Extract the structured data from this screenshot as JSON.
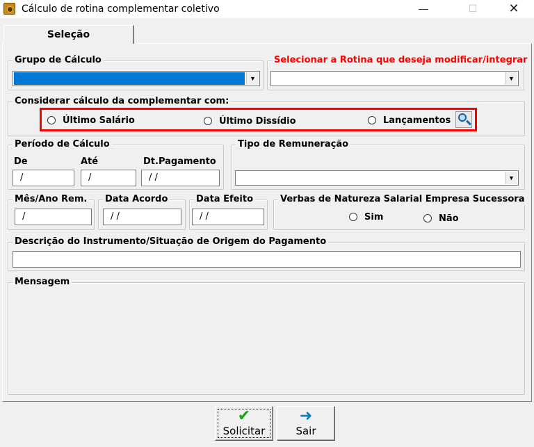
{
  "window": {
    "title": "Cálculo de rotina complementar coletivo",
    "minimize": "—",
    "maximize": "☐",
    "close": "✕"
  },
  "tab": {
    "label": "Seleção"
  },
  "grupo_calculo": {
    "legend": "Grupo de Cálculo",
    "value": ""
  },
  "rotina": {
    "legend": "Selecionar a Rotina que deseja modificar/integrar",
    "value": "",
    "legend_color": "#ff0000"
  },
  "considerar": {
    "legend": "Considerar cálculo da complementar com:",
    "options": [
      "Último Salário",
      "Último Dissídio",
      "Lançamentos"
    ]
  },
  "periodo": {
    "legend": "Período de Cálculo",
    "de_label": "De",
    "de_value": "/",
    "ate_label": "Até",
    "ate_value": "/",
    "pagamento_label": "Dt.Pagamento",
    "pagamento_value": "/ /"
  },
  "remuneracao": {
    "legend": "Tipo de Remuneração",
    "value": ""
  },
  "mes_ano": {
    "legend": "Mês/Ano Rem.",
    "value": "/"
  },
  "data_acordo": {
    "legend": "Data Acordo",
    "value": "/ /"
  },
  "data_efeito": {
    "legend": "Data Efeito",
    "value": "/ /"
  },
  "verbas": {
    "legend": "Verbas de Natureza Salarial Empresa Sucessora",
    "options": [
      "Sim",
      "Não"
    ]
  },
  "descricao": {
    "legend": "Descrição do Instrumento/Situação de Origem do Pagamento",
    "value": ""
  },
  "mensagem": {
    "legend": "Mensagem"
  },
  "buttons": {
    "solicitar": "Solicitar",
    "sair": "Sair"
  },
  "colors": {
    "accent": "#0078d7",
    "highlight": "#ff0000",
    "check": "#15a315"
  }
}
